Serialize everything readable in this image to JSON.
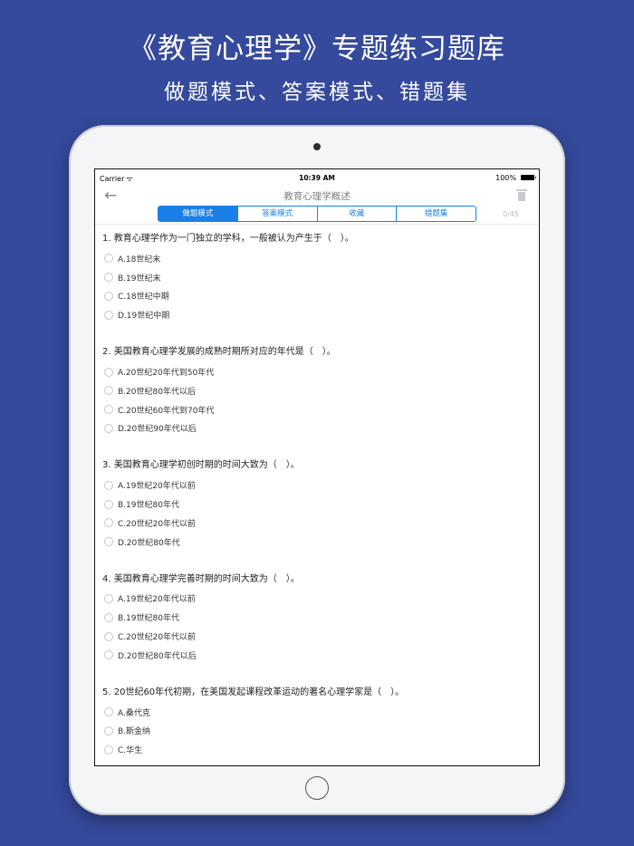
{
  "promo": {
    "title": "《教育心理学》专题练习题库",
    "subtitle": "做题模式、答案模式、错题集"
  },
  "status_bar": {
    "carrier": "Carrier",
    "time": "10:39 AM",
    "battery": "100%"
  },
  "nav": {
    "title": "教育心理学概述",
    "back_icon": "back-arrow-icon",
    "trash_icon": "trash-icon",
    "progress": "0/45"
  },
  "tabs": [
    {
      "label": "做题模式",
      "active": true
    },
    {
      "label": "答案模式",
      "active": false
    },
    {
      "label": "收藏",
      "active": false
    },
    {
      "label": "错题集",
      "active": false
    }
  ],
  "colors": {
    "background": "#354a9c",
    "accent": "#1a7fe8"
  },
  "questions": [
    {
      "text": "1. 教育心理学作为一门独立的学科，一般被认为产生于（　）。",
      "options": [
        "A.18世纪末",
        "B.19世纪末",
        "C.18世纪中期",
        "D.19世纪中期"
      ]
    },
    {
      "text": "2. 美国教育心理学发展的成熟时期所对应的年代是（　）。",
      "options": [
        "A.20世纪20年代到50年代",
        "B.20世纪80年代以后",
        "C.20世纪60年代到70年代",
        "D.20世纪90年代以后"
      ]
    },
    {
      "text": "3. 美国教育心理学初创时期的时间大致为（　）。",
      "options": [
        "A.19世纪20年代以前",
        "B.19世纪80年代",
        "C.20世纪20年代以前",
        "D.20世纪80年代"
      ]
    },
    {
      "text": "4. 美国教育心理学完善时期的时间大致为（　）。",
      "options": [
        "A.19世纪20年代以前",
        "B.19世纪80年代",
        "C.20世纪20年代以前",
        "D.20世纪80年代以后"
      ]
    },
    {
      "text": "5. 20世纪60年代初期，在美国发起课程改革运动的著名心理学家是（　）。",
      "options": [
        "A.桑代克",
        "B.斯金纳",
        "C.华生"
      ]
    }
  ]
}
